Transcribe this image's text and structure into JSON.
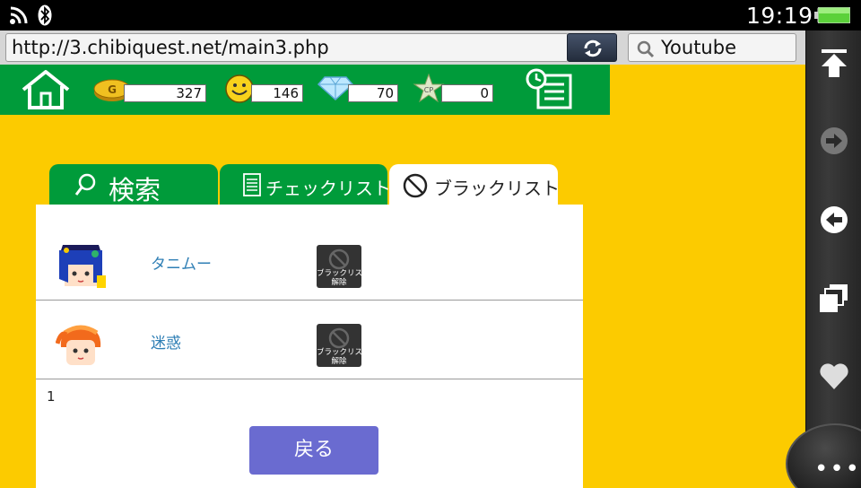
{
  "status_bar": {
    "time": "19:19",
    "icons": [
      "wifi-icon",
      "bluetooth-icon",
      "battery-icon"
    ]
  },
  "browser": {
    "url": "http://3.chibiquest.net/main3.php",
    "search_value": "Youtube",
    "sidebar_buttons": [
      "scroll-to-top-icon",
      "forward-icon",
      "back-icon",
      "windows-icon",
      "bookmark-heart-icon"
    ]
  },
  "header": {
    "gold": "327",
    "smile": "146",
    "diamond": "70",
    "cp": "0",
    "cp_label": "CP",
    "gold_label": "G"
  },
  "tabs": [
    {
      "label": "検索",
      "icon": "search-icon",
      "active": false
    },
    {
      "label": "チェックリスト",
      "icon": "list-icon",
      "active": false
    },
    {
      "label": "ブラックリスト",
      "icon": "prohibited-icon",
      "active": true
    }
  ],
  "blacklist": [
    {
      "name": "タニムー",
      "button_line1": "ブラックリスト",
      "button_line2": "解除"
    },
    {
      "name": "迷惑",
      "button_line1": "ブラックリスト",
      "button_line2": "解除"
    }
  ],
  "page_number": "1",
  "back_button": "戻る",
  "colors": {
    "background": "#fccb00",
    "header_green": "#009b3a",
    "back_button": "#6a6bd0",
    "link": "#2f7fb5"
  }
}
